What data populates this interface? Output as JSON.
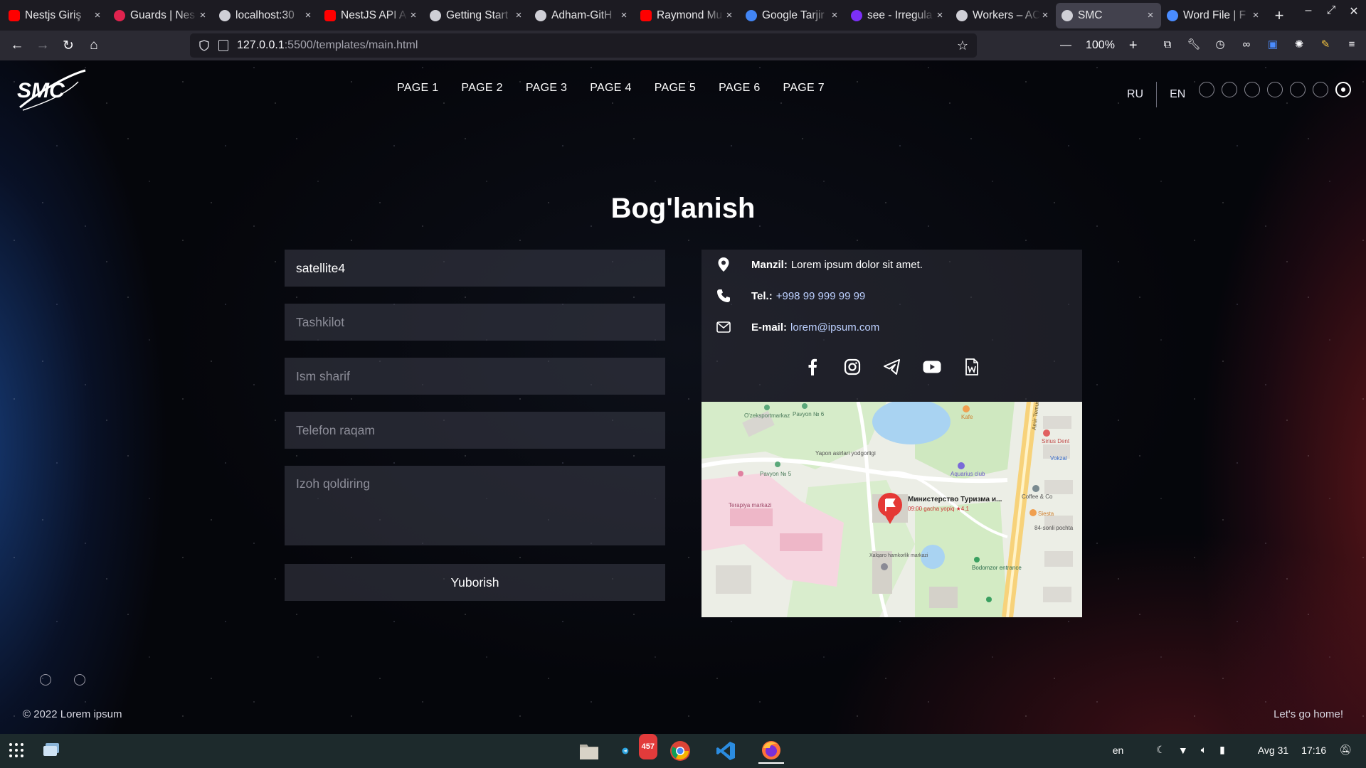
{
  "browser": {
    "tabs": [
      {
        "title": "Nestjs Giriş",
        "favicon": "youtube-icon",
        "color": "#ff0000"
      },
      {
        "title": "Guards | Nes",
        "favicon": "nestjs-icon",
        "color": "#e0234e"
      },
      {
        "title": "localhost:30",
        "favicon": "info-icon",
        "color": "#cfcfd6"
      },
      {
        "title": "NestJS API A",
        "favicon": "youtube-icon",
        "color": "#ff0000"
      },
      {
        "title": "Getting Start",
        "favicon": "github-icon",
        "color": "#cfcfd6"
      },
      {
        "title": "Adham-GitH",
        "favicon": "github-icon",
        "color": "#cfcfd6"
      },
      {
        "title": "Raymond Mu",
        "favicon": "youtube-icon",
        "color": "#ff0000"
      },
      {
        "title": "Google Tarjir",
        "favicon": "translate-icon",
        "color": "#4285f4"
      },
      {
        "title": "see - Irregula",
        "favicon": "h-icon",
        "color": "#7b2ff7"
      },
      {
        "title": "Workers – AC",
        "favicon": "page-icon",
        "color": "#cfcfd6"
      },
      {
        "title": "SMC",
        "favicon": "smc-icon",
        "color": "#cfcfd6",
        "active": true
      },
      {
        "title": "Word File | F",
        "favicon": "flag-icon",
        "color": "#4a8cff"
      }
    ],
    "url_host": "127.0.0.1",
    "url_path": ":5500/templates/main.html",
    "zoom": "100%"
  },
  "site": {
    "logo_text": "SMC",
    "nav": [
      "PAGE 1",
      "PAGE 2",
      "PAGE 3",
      "PAGE 4",
      "PAGE 5",
      "PAGE 6",
      "PAGE 7"
    ],
    "lang_ru": "RU",
    "lang_en": "EN",
    "page_dots": 7,
    "active_dot": 7
  },
  "contact": {
    "title": "Bog'lanish",
    "form": {
      "field1_value": "satellite4",
      "org_placeholder": "Tashkilot",
      "name_placeholder": "Ism sharif",
      "phone_placeholder": "Telefon raqam",
      "comment_placeholder": "Izoh qoldiring",
      "submit_label": "Yuborish"
    },
    "info": {
      "address_label": "Manzil:",
      "address_value": "Lorem ipsum dolor sit amet.",
      "phone_label": "Tel.:",
      "phone_value": "+998 99 999 99 99",
      "email_label": "E-mail:",
      "email_value": "lorem@ipsum.com"
    },
    "socials": [
      "facebook-icon",
      "instagram-icon",
      "telegram-icon",
      "youtube-icon",
      "word-file-icon"
    ],
    "map": {
      "place_name": "Министерство Туризма и...",
      "place_sub": "09:00 gacha yopiq ★4,1",
      "labels": [
        "O'zeksportmarkaz",
        "Pavyon № 6",
        "Yapon asirlari yodgorligi",
        "Pavyon № 5",
        "Terapiya markazi",
        "Aquarius club",
        "Kafe",
        "Sirius Dent",
        "Vokzal",
        "Coffee & Co",
        "Siesta",
        "84-sonli pochta",
        "Bodomzor entrance",
        "Xalqaro hamkorlik markazi",
        "Amir Temur"
      ]
    }
  },
  "footer": {
    "copyright": "© 2022 Lorem ipsum",
    "home_link": "Let's go home!"
  },
  "taskbar": {
    "badge_count": "457",
    "lang": "en",
    "date": "Avg 31",
    "time": "17:16"
  }
}
